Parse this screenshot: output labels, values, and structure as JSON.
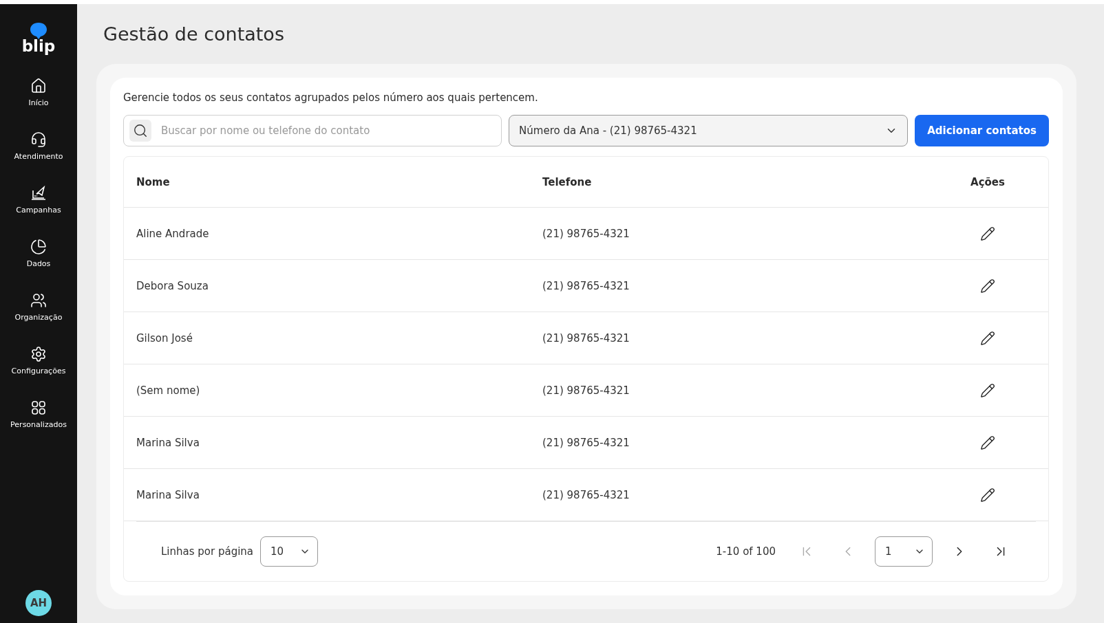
{
  "sidebar": {
    "logo": "blip",
    "items": [
      {
        "label": "Início"
      },
      {
        "label": "Atendimento"
      },
      {
        "label": "Campanhas"
      },
      {
        "label": "Dados"
      },
      {
        "label": "Organização"
      },
      {
        "label": "Configurações"
      },
      {
        "label": "Personalizados"
      }
    ],
    "avatar": "AH"
  },
  "page": {
    "title": "Gestão de contatos",
    "description": "Gerencie todos os seus contatos agrupados pelos número aos quais pertencem."
  },
  "search": {
    "placeholder": "Buscar por nome ou telefone do contato"
  },
  "number_select": {
    "value": "Número da Ana - (21) 98765-4321"
  },
  "add_button": "Adicionar contatos",
  "table": {
    "columns": [
      "Nome",
      "Telefone",
      "Ações"
    ],
    "rows": [
      {
        "name": "Aline Andrade",
        "phone": "(21) 98765-4321"
      },
      {
        "name": "Debora Souza",
        "phone": "(21) 98765-4321"
      },
      {
        "name": "Gilson José",
        "phone": "(21) 98765-4321"
      },
      {
        "name": "(Sem nome)",
        "phone": "(21) 98765-4321"
      },
      {
        "name": "Marina Silva",
        "phone": "(21) 98765-4321"
      },
      {
        "name": "Marina Silva",
        "phone": "(21) 98765-4321"
      }
    ]
  },
  "pagination": {
    "rows_label": "Linhas por página",
    "rows_per_page": "10",
    "range": "1-10 of 100",
    "page": "1",
    "buttons": [
      {
        "kind": "first",
        "disabled": true
      },
      {
        "kind": "prev",
        "disabled": true
      },
      {
        "kind": "page"
      },
      {
        "kind": "next",
        "disabled": false
      },
      {
        "kind": "last",
        "disabled": false
      }
    ]
  }
}
